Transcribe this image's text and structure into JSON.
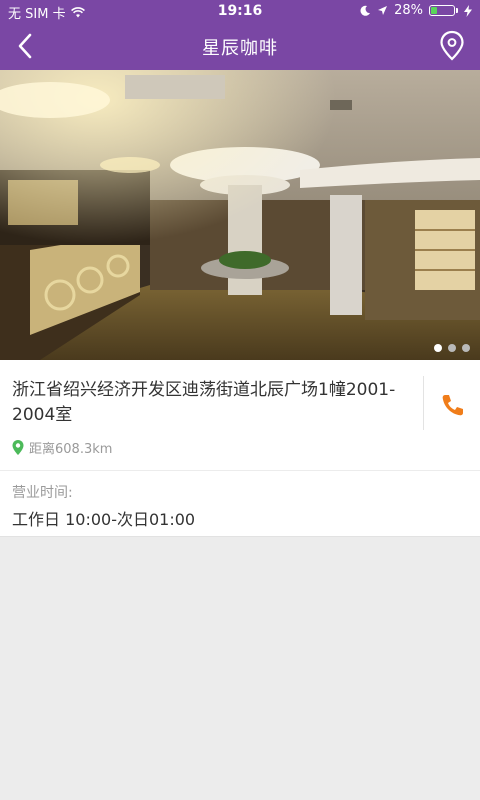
{
  "status_bar": {
    "carrier": "无 SIM 卡",
    "time": "19:16",
    "battery_percent": "28%",
    "battery_level": 0.28
  },
  "nav": {
    "title": "星辰咖啡",
    "back_icon": "chevron-left-icon",
    "map_icon": "location-pin-icon"
  },
  "gallery": {
    "image_count": 3,
    "active_index": 0
  },
  "store": {
    "address": "浙江省绍兴经济开发区迪荡街道北辰广场1幢2001-2004室",
    "distance": "距离608.3km",
    "hours_label": "营业时间:",
    "hours": "工作日 10:00-次日01:00"
  },
  "colors": {
    "brand": "#7a47a4",
    "call_icon": "#f07d1a",
    "distance_pin": "#4cba5a"
  }
}
